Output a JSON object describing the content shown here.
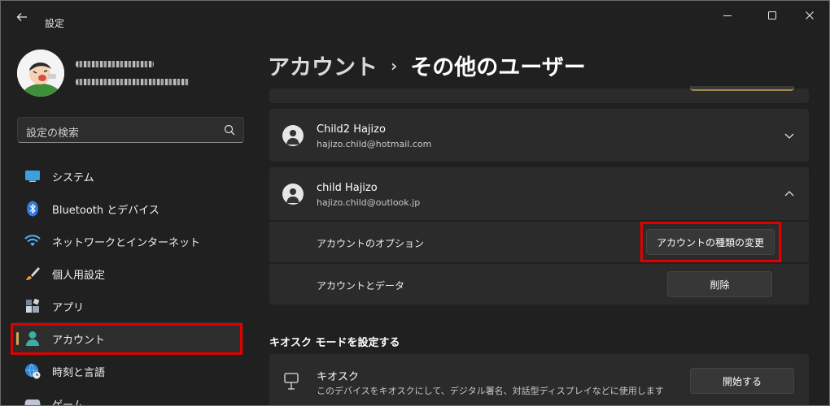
{
  "window": {
    "title": "設定"
  },
  "search": {
    "placeholder": "設定の検索"
  },
  "sidebar": {
    "items": [
      {
        "label": "システム",
        "icon": "monitor-icon"
      },
      {
        "label": "Bluetooth とデバイス",
        "icon": "bluetooth-icon"
      },
      {
        "label": "ネットワークとインターネット",
        "icon": "wifi-icon"
      },
      {
        "label": "個人用設定",
        "icon": "brush-icon"
      },
      {
        "label": "アプリ",
        "icon": "apps-icon"
      },
      {
        "label": "アカウント",
        "icon": "person-icon",
        "active": true
      },
      {
        "label": "時刻と言語",
        "icon": "globe-clock-icon"
      },
      {
        "label": "ゲーム",
        "icon": "gamepad-icon"
      }
    ]
  },
  "header": {
    "parent": "アカウント",
    "separator": "›",
    "current": "その他のユーザー"
  },
  "users": [
    {
      "name": "Child2 Hajizo",
      "email": "hajizo.child@hotmail.com",
      "expanded": false
    },
    {
      "name": "child Hajizo",
      "email": "hajizo.child@outlook.jp",
      "expanded": true
    }
  ],
  "expanded_options": {
    "account_options_label": "アカウントのオプション",
    "change_type_button": "アカウントの種類の変更",
    "account_data_label": "アカウントとデータ",
    "delete_button": "削除"
  },
  "kiosk": {
    "section_title": "キオスク モードを設定する",
    "title": "キオスク",
    "description": "このデバイスをキオスクにして、デジタル署名、対話型ディスプレイなどに使用します",
    "start_button": "開始する"
  },
  "colors": {
    "accent": "#d6a84b",
    "highlight": "#e00000",
    "background": "#202020",
    "card": "#2b2b2b"
  }
}
